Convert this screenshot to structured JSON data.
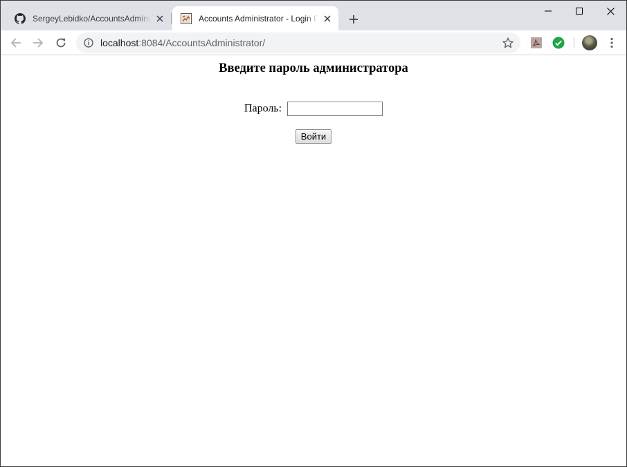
{
  "colors": {
    "tabstrip_bg": "#dee1e6",
    "omnibox_bg": "#f1f3f4",
    "check_green": "#1ea446"
  },
  "tabs": [
    {
      "title": "SergeyLebidko/AccountsAdminis",
      "icon": "github-icon",
      "active": false
    },
    {
      "title": "Accounts Administrator - Login P",
      "icon": "site-favicon-icon",
      "active": true
    }
  ],
  "address_bar": {
    "host": "localhost",
    "rest": ":8084/AccountsAdministrator/"
  },
  "page": {
    "heading": "Введите пароль администратора",
    "password_label": "Пароль:",
    "password_value": "",
    "submit_label": "Войти"
  }
}
